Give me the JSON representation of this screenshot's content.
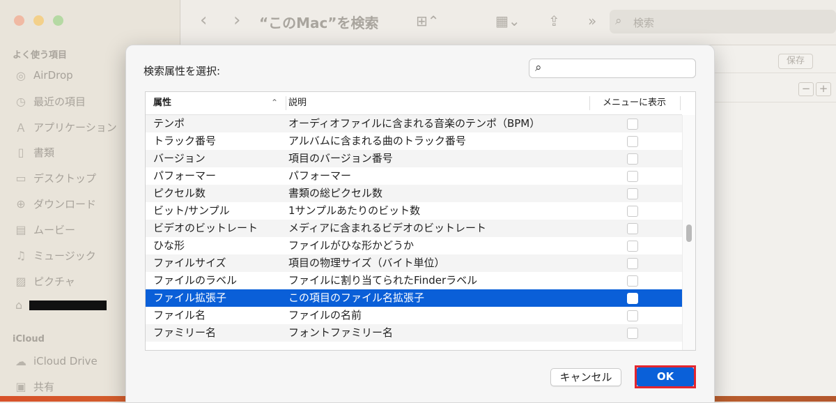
{
  "finder": {
    "title": "“このMac”を検索",
    "search_placeholder": "検索",
    "save_label": "保存",
    "minus_label": "−",
    "plus_label": "+",
    "sidebar": {
      "favorites_header": "よく使う項目",
      "items": [
        {
          "label": "AirDrop",
          "icon": "airdrop-icon"
        },
        {
          "label": "最近の項目",
          "icon": "clock-icon"
        },
        {
          "label": "アプリケーション",
          "icon": "apps-icon"
        },
        {
          "label": "書類",
          "icon": "document-icon"
        },
        {
          "label": "デスクトップ",
          "icon": "desktop-icon"
        },
        {
          "label": "ダウンロード",
          "icon": "download-icon"
        },
        {
          "label": "ムービー",
          "icon": "film-icon"
        },
        {
          "label": "ミュージック",
          "icon": "music-icon"
        },
        {
          "label": "ピクチャ",
          "icon": "photo-icon"
        }
      ],
      "icloud_header": "iCloud",
      "icloud_items": [
        {
          "label": "iCloud Drive",
          "icon": "cloud-icon"
        },
        {
          "label": "共有",
          "icon": "shared-folder-icon"
        }
      ]
    }
  },
  "dialog": {
    "title": "検索属性を選択:",
    "columns": {
      "attribute": "属性",
      "description": "説明",
      "show_in_menu": "メニューに表示"
    },
    "rows": [
      {
        "attr": "テンポ",
        "desc": "オーディオファイルに含まれる音楽のテンポ（BPM）",
        "checked": false
      },
      {
        "attr": "トラック番号",
        "desc": "アルバムに含まれる曲のトラック番号",
        "checked": false
      },
      {
        "attr": "バージョン",
        "desc": "項目のバージョン番号",
        "checked": false
      },
      {
        "attr": "パフォーマー",
        "desc": "パフォーマー",
        "checked": false
      },
      {
        "attr": "ピクセル数",
        "desc": "書類の総ピクセル数",
        "checked": false
      },
      {
        "attr": "ビット/サンプル",
        "desc": "1サンプルあたりのビット数",
        "checked": false
      },
      {
        "attr": "ビデオのビットレート",
        "desc": "メディアに含まれるビデオのビットレート",
        "checked": false
      },
      {
        "attr": "ひな形",
        "desc": "ファイルがひな形かどうか",
        "checked": false
      },
      {
        "attr": "ファイルサイズ",
        "desc": "項目の物理サイズ（バイト単位）",
        "checked": false
      },
      {
        "attr": "ファイルのラベル",
        "desc": "ファイルに割り当てられたFinderラベル",
        "checked": false
      },
      {
        "attr": "ファイル拡張子",
        "desc": "この項目のファイル名拡張子",
        "checked": false,
        "selected": true
      },
      {
        "attr": "ファイル名",
        "desc": "ファイルの名前",
        "checked": false
      },
      {
        "attr": "ファミリー名",
        "desc": "フォントファミリー名",
        "checked": false
      }
    ],
    "cancel_label": "キャンセル",
    "ok_label": "OK",
    "selected_color": "#0a5fd8",
    "highlight_color": "#e3262f"
  }
}
